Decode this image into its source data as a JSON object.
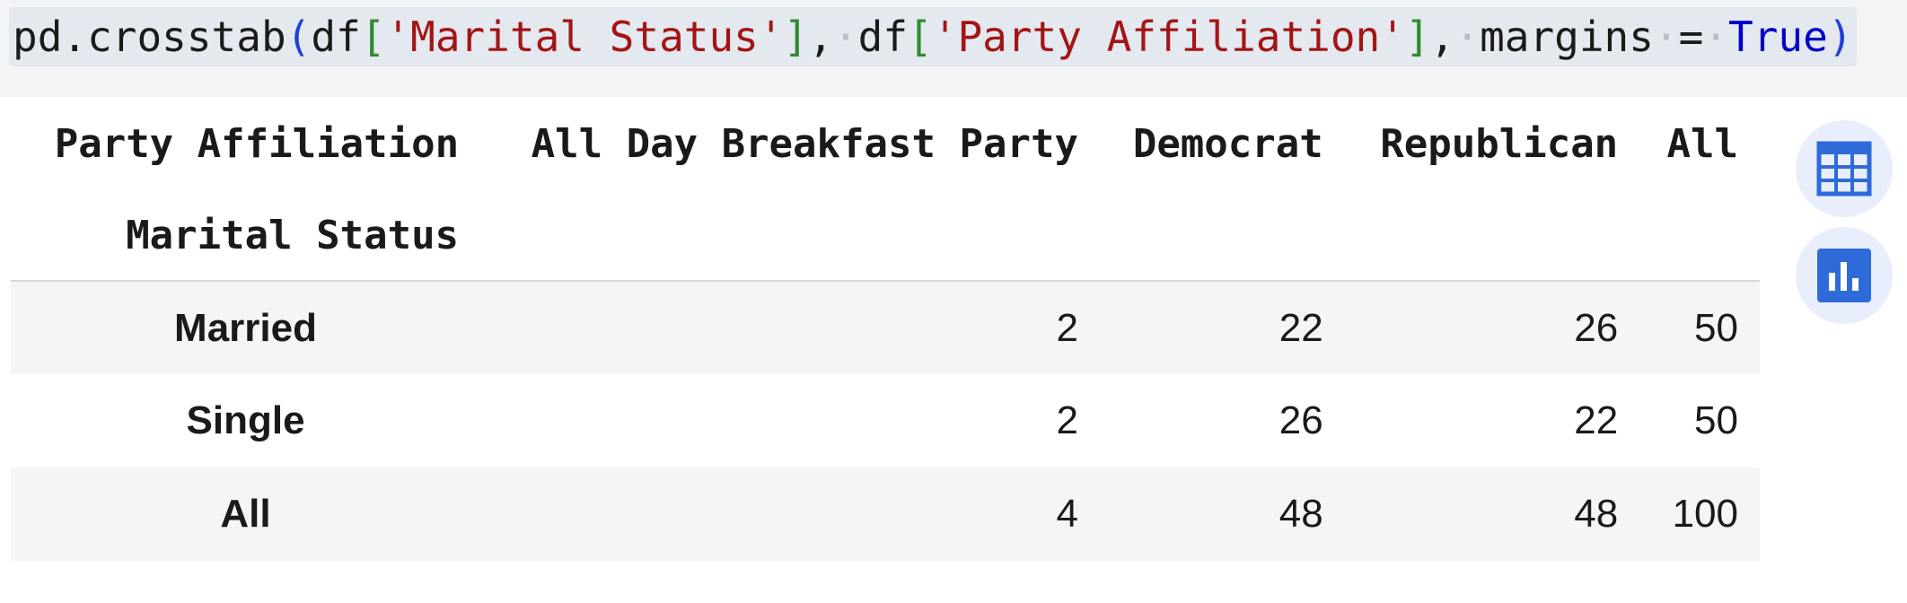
{
  "code_cell": {
    "func": "pd.crosstab",
    "open_paren": "(",
    "arg1_prefix": "df",
    "arg1_key": "'Marital Status'",
    "sep": ",",
    "arg2_prefix": "df",
    "arg2_key": "'Party Affiliation'",
    "kw_name": "margins",
    "kw_eq": "=",
    "kw_value": "True",
    "close_paren": ")"
  },
  "table": {
    "columns_name": "Party Affiliation",
    "index_name": "Marital Status",
    "columns": [
      "All Day Breakfast Party",
      "Democrat",
      "Republican",
      "All"
    ],
    "rows": [
      {
        "label": "Married",
        "values": [
          "2",
          "22",
          "26",
          "50"
        ]
      },
      {
        "label": "Single",
        "values": [
          "2",
          "26",
          "22",
          "50"
        ]
      },
      {
        "label": "All",
        "values": [
          "4",
          "48",
          "48",
          "100"
        ]
      }
    ]
  },
  "side_buttons": {
    "table_icon": "table-icon",
    "chart_icon": "bar-chart-icon",
    "accent": "#2f6bd8",
    "bg": "#e8eefb"
  }
}
